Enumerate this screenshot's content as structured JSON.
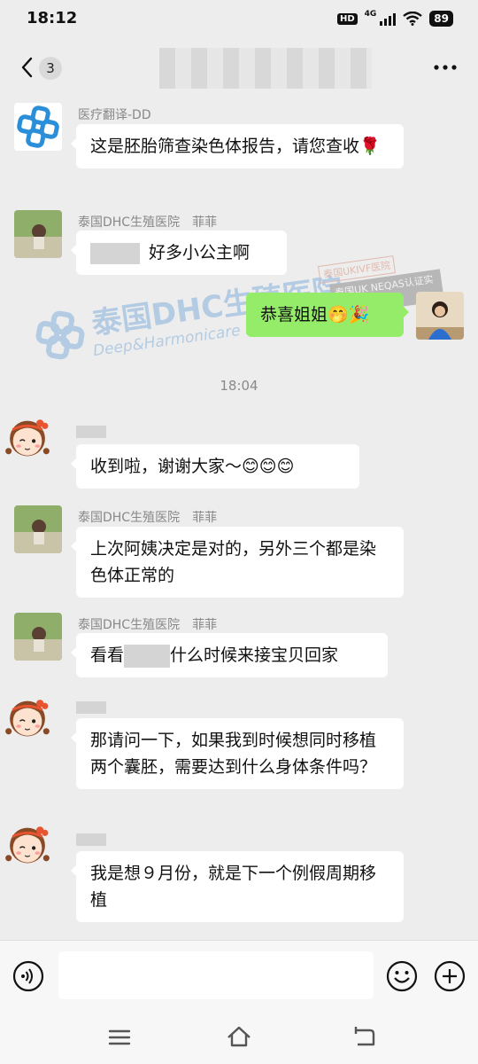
{
  "status_bar": {
    "time": "18:12",
    "hd": "HD",
    "network": "4G",
    "battery": "89"
  },
  "header": {
    "unread_count": "3",
    "title": ""
  },
  "watermark": {
    "cn": "泰国DHC生殖医院",
    "en": "Deep&Harmonicare IVF Center",
    "stamp1": "泰国UKIVF医院",
    "stamp2": "泰国UK NEQAS认证实验室"
  },
  "messages": [
    {
      "sender": "医疗翻译-DD",
      "text": "这是胚胎筛查染色体报告，请您查收🌹"
    },
    {
      "sender": "泰国DHC生殖医院　菲菲",
      "text": "好多小公主啊"
    },
    {
      "text": "恭喜姐姐🤭🎉"
    },
    {
      "time": "18:04"
    },
    {
      "text": "收到啦，谢谢大家～😊😊😊"
    },
    {
      "sender": "泰国DHC生殖医院　菲菲",
      "text": "上次阿姨决定是对的，另外三个都是染色体正常的"
    },
    {
      "sender": "泰国DHC生殖医院　菲菲",
      "text_a": "看看",
      "text_b": "什么时候来接宝贝回家"
    },
    {
      "text": "那请问一下，如果我到时候想同时移植两个囊胚，需要达到什么身体条件吗？"
    },
    {
      "text": "我是想９月份，就是下一个例假周期移植"
    }
  ],
  "input": {
    "value": "",
    "placeholder": ""
  },
  "colors": {
    "my_bubble": "#95ec69",
    "their_bubble": "#ffffff",
    "chat_bg": "#ededed"
  }
}
